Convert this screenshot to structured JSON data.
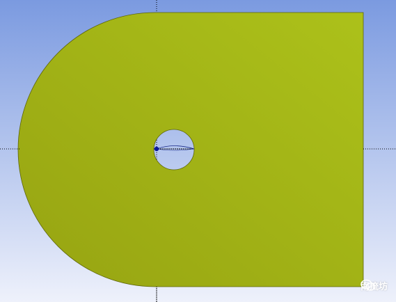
{
  "viewport": {
    "background_top": "#7b9ae0",
    "background_bottom": "#eef1fb"
  },
  "geometry": {
    "face_color_light": "#acc11a",
    "face_color_dark": "#97a412",
    "edge_color": "#5c6408",
    "hole_fill": "#b5c6ef",
    "axis_color": "#000000",
    "vertex_color": "#0b1a9c"
  },
  "watermark": {
    "icon": "wechat-icon",
    "text": "南流坊"
  }
}
